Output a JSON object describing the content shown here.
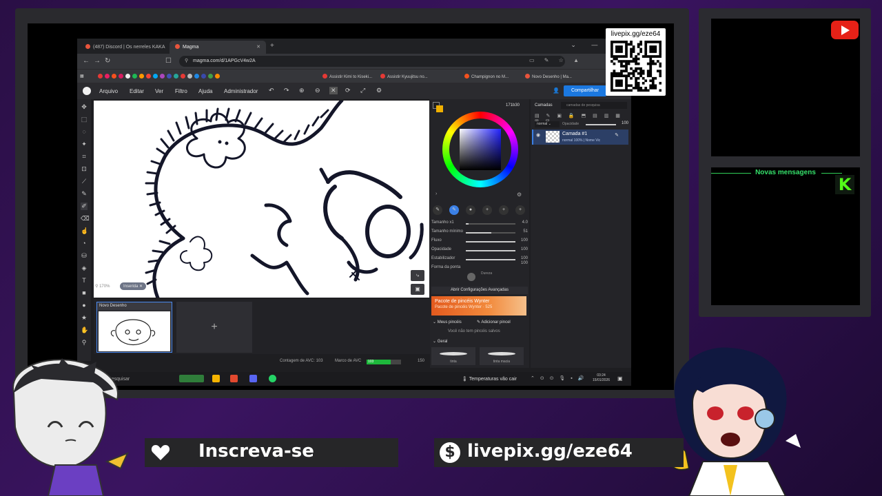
{
  "browser": {
    "tabs": [
      {
        "label": "(487) Discord | Os nerreles KAKA",
        "active": false
      },
      {
        "label": "Magma",
        "active": true
      }
    ],
    "url": "magma.com/d/1APGcV4w2A",
    "bookmarks": [
      "Assistir Kimi to Kiseki...",
      "Assistir Kyuujitsu no...",
      "Champignon no M...",
      "Novo Desenho | Ma..."
    ]
  },
  "app": {
    "menu": [
      "Arquivo",
      "Editar",
      "Ver",
      "Filtro",
      "Ajuda",
      "Administrador"
    ],
    "share_label": "Compartilhar",
    "canvas": {
      "zoom": "170%",
      "blend_badge": "Inserida"
    },
    "color": {
      "hex": "171b30"
    },
    "sliders": [
      {
        "label": "Tamanho x1",
        "value": "4.0",
        "level": 0.05
      },
      {
        "label": "Tamanho mínimo",
        "value": "51",
        "level": 0.51
      },
      {
        "label": "Fluxo",
        "value": "100",
        "level": 1.0
      },
      {
        "label": "Opacidade",
        "value": "100",
        "level": 1.0
      },
      {
        "label": "Estabilizador",
        "value": "100",
        "level": 1.0
      },
      {
        "label": "Forma da ponta",
        "value": "100",
        "level": 1.0
      }
    ],
    "dureza_label": "Dureza",
    "advanced_label": "Abrir Configurações Avançadas",
    "pack": {
      "title": "Pacote de pincéis Wynter",
      "subtitle": "Pacote de pincéis Wynter · 525"
    },
    "my_brushes": "Meus pincéis",
    "add_brush": "Adicionar pincel",
    "no_brushes": "Você não tem pincéis salvos",
    "geral": "Geral",
    "brush_cards": [
      "tinta",
      "tinta macia"
    ],
    "layers": {
      "header": "Camadas",
      "search_placeholder": "camadas de pesquisa",
      "blend": "normal",
      "opacity_label": "Opacidade",
      "opacity_value": "100",
      "layer_name": "Camada #1",
      "layer_meta": "normal 100% | Nome Vic"
    },
    "drawings": {
      "card_title": "Novo Desenho",
      "add": "+"
    },
    "status": {
      "avc_count_label": "Contagem de AVC: 103",
      "avc_mark_label": "Marco de AVC",
      "avc_value": "103",
      "avc_max": "150",
      "avc_fraction": 0.69
    }
  },
  "taskbar": {
    "search": "Pesquisar",
    "weather": "Temperaturas vão cair",
    "time": "03:24",
    "date": "15/01/2026"
  },
  "overlay": {
    "qr_label": "livepix.gg/eze64",
    "chat_title": "Novas mensagens",
    "subscribe": "Inscreva-se",
    "donate": "livepix.gg/eze64"
  },
  "colors": {
    "accent_blue": "#1b78e0",
    "avc_green": "#1eb83c",
    "kick_green": "#53fc18",
    "youtube_red": "#e62117"
  }
}
